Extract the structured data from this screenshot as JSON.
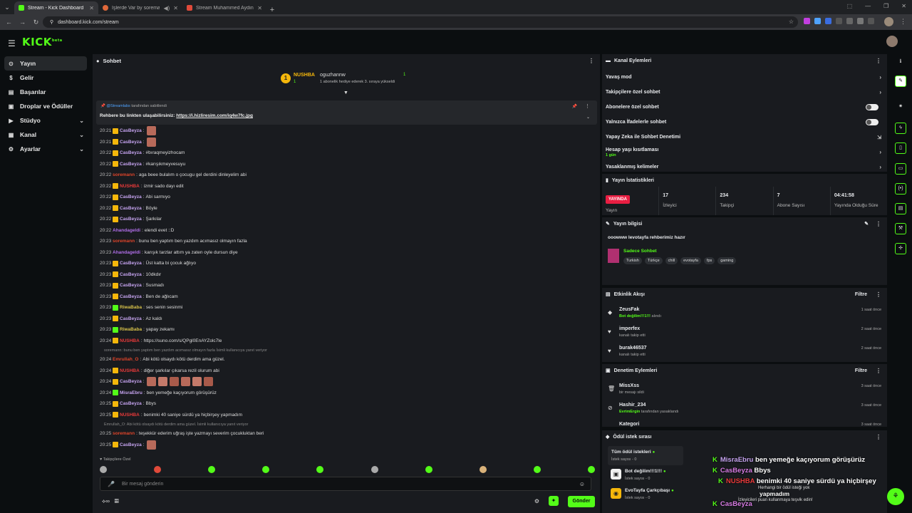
{
  "browser": {
    "tabs": [
      {
        "title": "Stream - Kick Dashboard",
        "color": "#53fc18",
        "active": true
      },
      {
        "title": "İşlerde Var by soremann | K",
        "color": "#e0683a",
        "active": false
      },
      {
        "title": "Stream Muhammed Aydın mu:",
        "color": "#e04a3a",
        "active": false
      }
    ],
    "url": "dashboard.kick.com/stream"
  },
  "app": {
    "logo": "KICK",
    "logo_sup": "beta"
  },
  "sidebar": {
    "items": [
      {
        "label": "Yayın",
        "icon": "⊙",
        "active": true,
        "chevron": ""
      },
      {
        "label": "Gelir",
        "icon": "$",
        "active": false,
        "chevron": ""
      },
      {
        "label": "Başarılar",
        "icon": "▤",
        "active": false,
        "chevron": ""
      },
      {
        "label": "Droplar ve Ödüller",
        "icon": "▣",
        "active": false,
        "chevron": ""
      },
      {
        "label": "Stüdyo",
        "icon": "▶",
        "active": false,
        "chevron": "⌄"
      },
      {
        "label": "Kanal",
        "icon": "▦",
        "active": false,
        "chevron": "⌄"
      },
      {
        "label": "Ayarlar",
        "icon": "⚙",
        "active": false,
        "chevron": "⌄"
      }
    ]
  },
  "chat": {
    "title": "Sohbet",
    "goal": {
      "name": "NUSHBA",
      "count": "1",
      "name2": "oguzhannw",
      "desc": "1 abonelik hediye ederek 3. sıraya yükseldi",
      "count2": "1"
    },
    "pinned": {
      "by_user": "@Streamlabs",
      "by_text": "tarafından sabitlendi",
      "text": "Rehbere bu linkten ulaşabilirsiniz:",
      "link": "https://i.hizliresim.com/iq4w7fc.jpg"
    },
    "messages": [
      {
        "t": "20:21",
        "user": "CasBeyza",
        "color": "#c5a3ef",
        "badge": "#f5b70b",
        "text": "",
        "emotes": 1
      },
      {
        "t": "20:21",
        "user": "CasBeyza",
        "color": "#c5a3ef",
        "badge": "#f5b70b",
        "text": "",
        "emotes": 1
      },
      {
        "t": "20:22",
        "user": "CasBeyza",
        "color": "#c5a3ef",
        "badge": "#f5b70b",
        "text": "#bıraqmeyizhocam",
        "emotes": 0
      },
      {
        "t": "20:22",
        "user": "CasBeyza",
        "color": "#c5a3ef",
        "badge": "#f5b70b",
        "text": "#karışıkmeyvesuyu",
        "emotes": 0
      },
      {
        "t": "20:22",
        "user": "soremann",
        "color": "#e0452a",
        "badge": "",
        "text": "aga beee bulalım o çocugu gel derdini dinleyelim abi",
        "emotes": 0
      },
      {
        "t": "20:22",
        "user": "NUSHBA",
        "color": "#e83a3a",
        "badge": "#f5b70b",
        "text": "izmir sado dayı edit",
        "emotes": 0
      },
      {
        "t": "20:22",
        "user": "CasBeyza",
        "color": "#c5a3ef",
        "badge": "#f5b70b",
        "text": "Abi sarmıyo",
        "emotes": 0
      },
      {
        "t": "20:22",
        "user": "CasBeyza",
        "color": "#c5a3ef",
        "badge": "#f5b70b",
        "text": "Böyle",
        "emotes": 0
      },
      {
        "t": "20:22",
        "user": "CasBeyza",
        "color": "#c5a3ef",
        "badge": "#f5b70b",
        "text": "Şarkılar",
        "emotes": 0
      },
      {
        "t": "20:22",
        "user": "Ahandageldi",
        "color": "#b06ee8",
        "badge": "",
        "text": "elendi evet ::D",
        "emotes": 0
      },
      {
        "t": "20:23",
        "user": "soremann",
        "color": "#e0452a",
        "badge": "",
        "text": "bunu ben yaptım ben yazdım acımasız olmayın fazla",
        "emotes": 0
      },
      {
        "t": "20:23",
        "user": "Ahandageldi",
        "color": "#b06ee8",
        "badge": "",
        "text": "karışık tarzlar attım ya zaten oyle dursun diye",
        "emotes": 0
      },
      {
        "t": "20:23",
        "user": "CasBeyza",
        "color": "#c5a3ef",
        "badge": "#f5b70b",
        "text": "Üst katta bi çocuk ağlıyo",
        "emotes": 0
      },
      {
        "t": "20:23",
        "user": "CasBeyza",
        "color": "#c5a3ef",
        "badge": "#f5b70b",
        "text": "10dkdır",
        "emotes": 0
      },
      {
        "t": "20:23",
        "user": "CasBeyza",
        "color": "#c5a3ef",
        "badge": "#f5b70b",
        "text": "Susmadı",
        "emotes": 0
      },
      {
        "t": "20:23",
        "user": "CasBeyza",
        "color": "#c5a3ef",
        "badge": "#f5b70b",
        "text": "Ben de ağlıcam",
        "emotes": 0
      },
      {
        "t": "20:23",
        "user": "RiwaBaba",
        "color": "#d8c24a",
        "badge": "#53fc18",
        "text": "ses senin sesinmi",
        "emotes": 0
      },
      {
        "t": "20:23",
        "user": "CasBeyza",
        "color": "#c5a3ef",
        "badge": "#f5b70b",
        "text": "Az kaldı",
        "emotes": 0
      },
      {
        "t": "20:23",
        "user": "RiwaBaba",
        "color": "#d8c24a",
        "badge": "#53fc18",
        "text": "yapay zekamı",
        "emotes": 0
      },
      {
        "t": "20:24",
        "user": "NUSHBA",
        "color": "#e83a3a",
        "badge": "#f5b70b",
        "text": "https://suno.com/s/QPgl0EnAYZolc7le",
        "emotes": 0
      }
    ],
    "reply_note_1": "soremann: bunu ben yaptım ben yazdım acımasız olmayın fazla İsimli kullanıcıya yanıt veriyor",
    "messages2": [
      {
        "t": "20:24",
        "user": "Emrullah_O",
        "color": "#e0452a",
        "badge": "",
        "text": "Abi kötü olsaydı kötü derdim ama güzel.",
        "emotes": 0
      },
      {
        "t": "20:24",
        "user": "NUSHBA",
        "color": "#e83a3a",
        "badge": "#f5b70b",
        "text": "diğer şarkılar çıkarsa rezil olurum abi",
        "emotes": 0
      },
      {
        "t": "20:24",
        "user": "CasBeyza",
        "color": "#c5a3ef",
        "badge": "#f5b70b",
        "text": "",
        "emotes": 6
      },
      {
        "t": "20:24",
        "user": "MisraEbru",
        "color": "#c5a3ef",
        "badge": "#53fc18",
        "text": "ben yemeğe kaçıyorum görüşürüz",
        "emotes": 0
      },
      {
        "t": "20:25",
        "user": "CasBeyza",
        "color": "#c5a3ef",
        "badge": "#f5b70b",
        "text": "Bbys",
        "emotes": 0
      },
      {
        "t": "20:25",
        "user": "NUSHBA",
        "color": "#e83a3a",
        "badge": "#f5b70b",
        "text": "benimki 40 saniye sürdü ya hiçbirşey yapmadım",
        "emotes": 0
      }
    ],
    "reply_note_2": "Emrullah_O: Abi kötü olsaydı kötü derdim ama güzel. İsimli kullanıcıya yanıt veriyor",
    "messages3": [
      {
        "t": "20:25",
        "user": "soremann",
        "color": "#e0452a",
        "badge": "",
        "text": "teşekkür ederim uğraş işte yazmayı severim çocukluktan beri",
        "emotes": 0
      },
      {
        "t": "20:25",
        "user": "CasBeyza",
        "color": "#c5a3ef",
        "badge": "#f5b70b",
        "text": "",
        "emotes": 1
      }
    ],
    "followers_only": "Takipçilere Özel",
    "input_placeholder": "Bir mesaj gönderin",
    "send_label": "Gönder"
  },
  "channel_actions": {
    "title": "Kanal Eylemleri",
    "items": [
      {
        "label": "Yavaş mod",
        "type": "chevron"
      },
      {
        "label": "Takipçilere özel sohbet",
        "type": "chevron"
      },
      {
        "label": "Abonelere özel sohbet",
        "type": "toggle"
      },
      {
        "label": "Yalnızca İfadelerle sohbet",
        "type": "toggle"
      },
      {
        "label": "Yapay Zeka ile Sohbet Denetimi",
        "type": "ext"
      },
      {
        "label": "Hesap yaşı kısıtlaması",
        "sub": "1 gün",
        "type": "chevron"
      },
      {
        "label": "Yasaklanmış kelimeler",
        "type": "chevron"
      }
    ]
  },
  "stream_stats": {
    "title": "Yayın İstatistikleri",
    "live_badge": "YAYINDA",
    "stats": [
      {
        "value": "",
        "label": "Yayın"
      },
      {
        "value": "17",
        "label": "İzleyici"
      },
      {
        "value": "234",
        "label": "Takipçi"
      },
      {
        "value": "7",
        "label": "Abone Sayısı"
      },
      {
        "value": "04:41:58",
        "label": "Yayında Olduğu Süre"
      }
    ]
  },
  "stream_info": {
    "title": "Yayın bilgisi",
    "stream_title": "ooowww levotayfa rehberimiz hazır",
    "category": "Sadece Sohbet",
    "tags": [
      "Turkish",
      "Türkçe",
      "chill",
      "evotayfa",
      "fps",
      "gaming"
    ]
  },
  "activity": {
    "title": "Etkinlik Akışı",
    "filter": "Filtre",
    "items": [
      {
        "icon": "◆",
        "name": "ZeusFak",
        "hl": "Bot değilim!!!1!!!",
        "desc": " alındı",
        "time": "1 saat önce"
      },
      {
        "icon": "♥",
        "name": "imperfex",
        "hl": "",
        "desc": "kanalı takip etti",
        "time": "2 saat önce"
      },
      {
        "icon": "♥",
        "name": "burak46537",
        "hl": "",
        "desc": "kanalı takip etti",
        "time": "2 saat önce"
      }
    ]
  },
  "moderation": {
    "title": "Denetim Eylemleri",
    "filter": "Filtre",
    "items": [
      {
        "icon": "🗑",
        "name": "MissXss",
        "hl": "",
        "desc": "bir mesajı sildi",
        "time": "3 saat önce"
      },
      {
        "icon": "⊘",
        "name": "Hashir_234",
        "hl": "EvrimErgin",
        "desc": " tarafından yasaklandı",
        "time": "3 saat önce"
      },
      {
        "icon": "",
        "name": "Kategori",
        "hl": "",
        "desc": "",
        "time": "3 saat önce"
      }
    ]
  },
  "rewards": {
    "title": "Ödül istek sırası",
    "items": [
      {
        "name": "Tüm ödül istekleri",
        "desc": "İstek sayısı - 0",
        "icon": "",
        "iconbg": ""
      },
      {
        "name": "Bot değilim!!!1!!!",
        "desc": "İstek sayısı - 0",
        "icon": "▣",
        "iconbg": "#f1f1f1"
      },
      {
        "name": "EvoTayfa Çarkçıbaşı",
        "desc": "İstek sayısı - 0",
        "icon": "◉",
        "iconbg": "#f5b70b"
      }
    ],
    "empty_title": "Herhangi bir ödül isteği yok",
    "empty_desc": "İzleyicileri puan kullanmaya teşvik edin!"
  },
  "overlay": {
    "lines": [
      {
        "user": "MisraEbru",
        "text": "ben yemeğe kaçıyorum görüşürüz"
      },
      {
        "user": "CasBeyza",
        "text": "Bbys"
      },
      {
        "user": "NUSHBA",
        "text": "benimki 40 saniye sürdü ya hiçbirşey"
      },
      {
        "user": "",
        "text": "yapmadım"
      },
      {
        "user": "CasBeyza",
        "text": ""
      }
    ]
  },
  "colors": {
    "accent": "#53fc18",
    "live": "#e91e42",
    "panel": "#191b1f",
    "bg": "#0b0e10"
  }
}
